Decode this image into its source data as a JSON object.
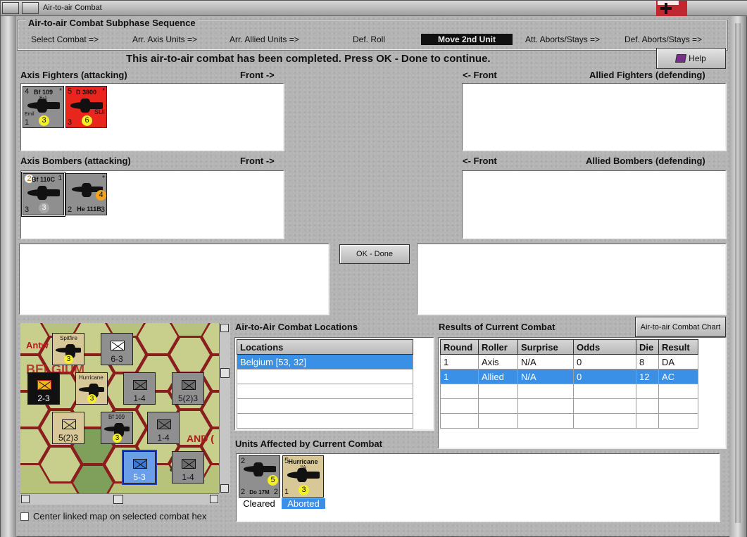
{
  "window": {
    "title": "Air-to-air Combat"
  },
  "subphase": {
    "title": "Air-to-air Combat Subphase Sequence",
    "steps": [
      "Select Combat =>",
      "Arr. Axis Units =>",
      "Arr. Allied Units =>",
      "Def. Roll",
      "Move 2nd Unit",
      "Att. Aborts/Stays =>",
      "Def. Aborts/Stays =>"
    ],
    "active_step": "Move 2nd Unit"
  },
  "message": "This air-to-air combat has been completed.  Press OK - Done to continue.",
  "help_button": "Help",
  "axis_fighters": {
    "label": "Axis Fighters (attacking)",
    "front": "Front ->",
    "units": [
      {
        "type": "Bf 109",
        "subtype": "E-1",
        "side_name": "Emil",
        "air_to_air": "4",
        "range": "1",
        "move": "3",
        "star": "*",
        "color": "#8f8f8f"
      },
      {
        "type": "D 3800",
        "subtype": "",
        "side_name": "SUI",
        "air_to_air": "5",
        "range": "3",
        "move": "6",
        "star": "*",
        "color": "#e8261e"
      }
    ]
  },
  "allied_fighters": {
    "label": "Allied Fighters (defending)",
    "front": "<- Front"
  },
  "axis_bombers": {
    "label": "Axis Bombers (attacking)",
    "front": "Front ->",
    "units": [
      {
        "type": "Bf 110C",
        "tl": "2",
        "bl": "3",
        "center": "3",
        "tr": "1",
        "color": "#8f8f8f"
      },
      {
        "type": "He 111B",
        "tl": "",
        "bl": "2",
        "center": "4",
        "tr": "*",
        "br": "3",
        "color": "#8f8f8f"
      }
    ]
  },
  "allied_bombers": {
    "label": "Allied Bombers (defending)",
    "front": "<- Front"
  },
  "ok_button": "OK - Done",
  "chart_button": "Air-to-air Combat Chart",
  "locations": {
    "label": "Air-to-Air Combat Locations",
    "header": "Locations",
    "rows": [
      "Belgium [53, 32]"
    ]
  },
  "results": {
    "label": "Results of Current Combat",
    "headers": [
      "Round",
      "Roller",
      "Surprise",
      "Odds",
      "Die",
      "Result"
    ],
    "rows": [
      [
        "1",
        "Axis",
        "N/A",
        "0",
        "8",
        "DA"
      ],
      [
        "1",
        "Allied",
        "N/A",
        "0",
        "12",
        "AC"
      ]
    ]
  },
  "affected": {
    "label": "Units Affected by Current Combat",
    "units": [
      {
        "type": "Do 17M",
        "tl": "2",
        "bl": "2",
        "br": "2",
        "center": "5",
        "status": "Cleared"
      },
      {
        "type": "Hurricane",
        "subtype": "IIA",
        "tl": "5",
        "bl": "1",
        "center": "3",
        "status": "Aborted"
      }
    ]
  },
  "map": {
    "labels": [
      "Antw",
      "BELGIUM",
      "AND (",
      "arl"
    ],
    "counters": [
      {
        "label": "6-3"
      },
      {
        "label": "2-3"
      },
      {
        "label": "1-4"
      },
      {
        "label": "5(2)3"
      },
      {
        "label": "5(2)3"
      },
      {
        "label": "1-4"
      },
      {
        "label": "5-3"
      },
      {
        "label": "1-4"
      }
    ],
    "fighters": [
      {
        "type": "Spitfire",
        "value": "3"
      },
      {
        "type": "Hurricane",
        "value": "3"
      },
      {
        "type": "Bf 109",
        "subtype": "E-1",
        "value": "3"
      }
    ]
  },
  "center_map_checkbox": {
    "label": "Center linked map on selected combat hex",
    "checked": false
  }
}
